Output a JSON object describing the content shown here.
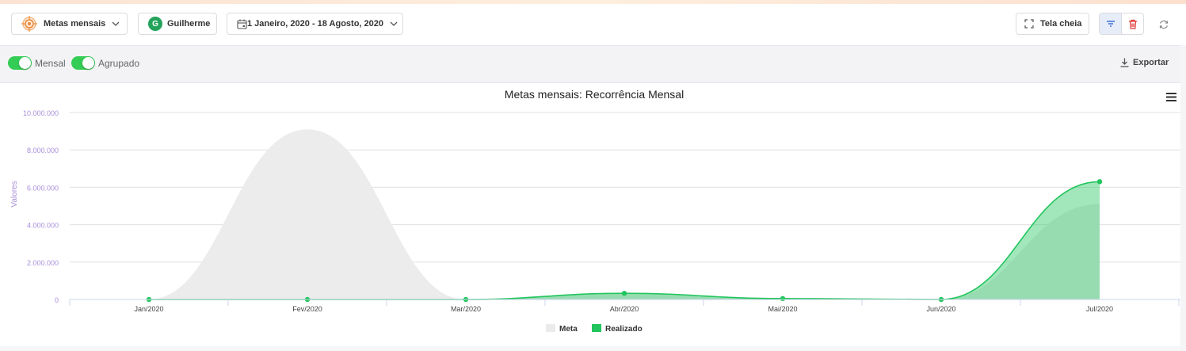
{
  "toolbar": {
    "metas_label": "Metas mensais",
    "user_initial": "G",
    "user_name": "Guilherme",
    "date_range": "1 Janeiro, 2020 - 18 Agosto, 2020",
    "fullscreen_label": "Tela cheia"
  },
  "subbar": {
    "toggle_mensal_label": "Mensal",
    "toggle_agrupado_label": "Agrupado",
    "toggle_mensal_on": true,
    "toggle_agrupado_on": true,
    "export_label": "Exportar"
  },
  "colors": {
    "accent_green": "#22c55e",
    "toggle_green": "#33cc55",
    "meta_gray": "#ebebeb",
    "axis_purple": "#a98ed8",
    "delete_red": "#e03131",
    "filter_blue": "#3b6fd8"
  },
  "icons": {
    "metas": "target-icon",
    "date": "calendar-icon",
    "fullscreen": "expand-icon",
    "filter": "filter-icon",
    "delete": "trash-icon",
    "refresh": "refresh-icon",
    "export": "download-icon",
    "menu": "hamburger-menu-icon"
  },
  "chart_data": {
    "type": "area",
    "title": "Metas mensais: Recorrência Mensal",
    "ylabel": "Valores",
    "xlabel": "",
    "categories": [
      "Jan/2020",
      "Fev/2020",
      "Mar/2020",
      "Abr/2020",
      "Mai/2020",
      "Jun/2020",
      "Jul/2020"
    ],
    "ylim": [
      0,
      10000000
    ],
    "yticks": [
      "0",
      "2.000.000",
      "4.000.000",
      "6.000.000",
      "8.000.000",
      "10.000.000"
    ],
    "grid": true,
    "legend_position": "bottom-center",
    "series": [
      {
        "name": "Meta",
        "values": [
          0,
          9100000,
          0,
          300000,
          100000,
          0,
          5100000
        ],
        "color": "#ebebeb"
      },
      {
        "name": "Realizado",
        "values": [
          0,
          0,
          0,
          330000,
          50000,
          0,
          6300000
        ],
        "color": "#22c55e"
      }
    ]
  }
}
